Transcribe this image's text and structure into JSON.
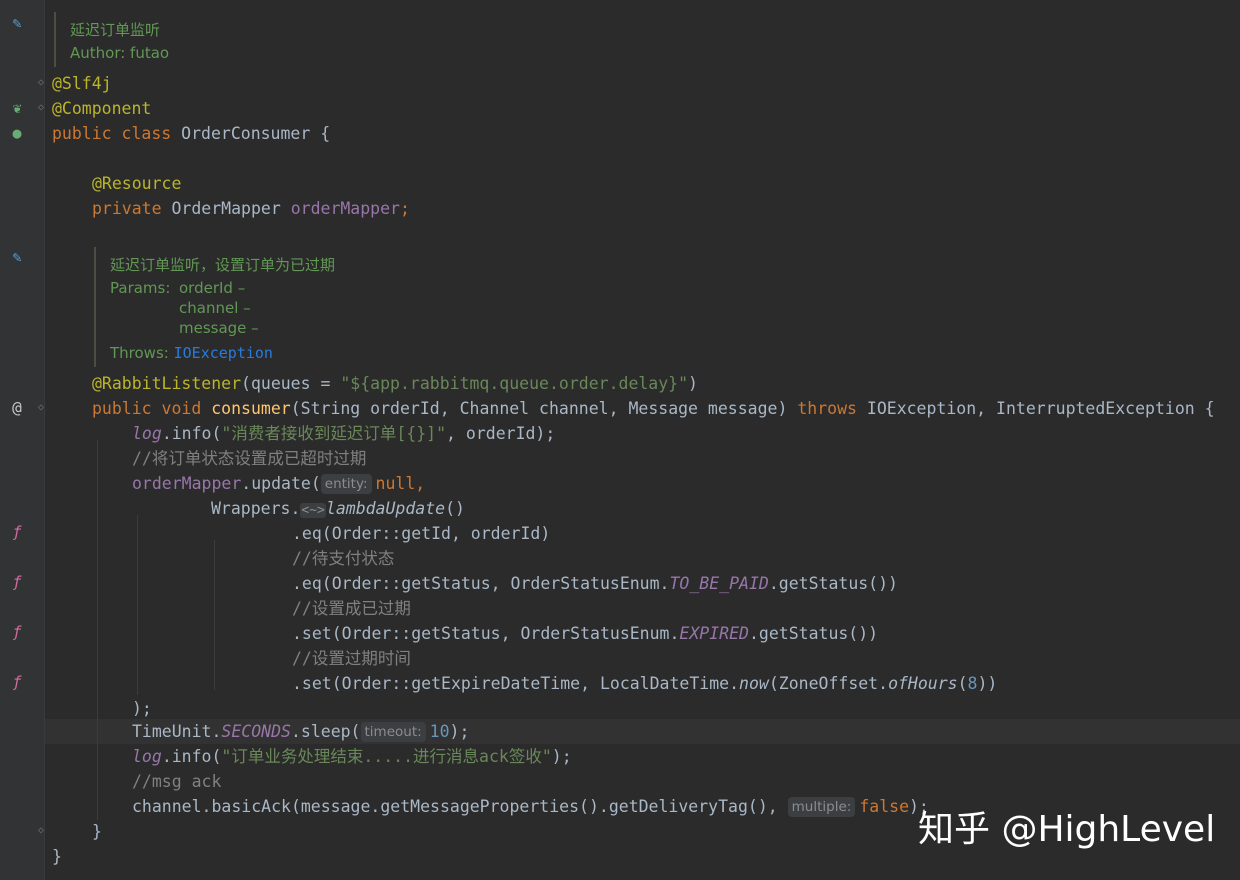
{
  "doc1": {
    "title": "延迟订单监听",
    "author": "Author: futao"
  },
  "anno": {
    "slf4j": "@Slf4j",
    "component": "@Component",
    "resource": "@Resource",
    "rabbit": "@RabbitListener"
  },
  "class_decl": {
    "pub": "public",
    "cls": "class",
    "name": "OrderConsumer {"
  },
  "field": {
    "kw": "private",
    "type": "OrderMapper",
    "name": "orderMapper",
    "semi": ";"
  },
  "doc2": {
    "title": "延迟订单监听，设置订单为已过期",
    "params_label": "Params:",
    "p1": "orderId –",
    "p2": "channel –",
    "p3": "message –",
    "throws_label": "Throws:",
    "throws_val": "IOException"
  },
  "listener": {
    "open": "(queues = ",
    "value": "\"${app.rabbitmq.queue.order.delay}\"",
    "close": ")"
  },
  "method": {
    "kw": "public void",
    "name": "consumer",
    "sig": "(String orderId, Channel channel, Message message) ",
    "throws_kw": "throws",
    "exc": " IOException, InterruptedException {"
  },
  "body": {
    "log1_obj": "log",
    "log1_call": ".info(",
    "log1_str": "\"消费者接收到延迟订单[{}]\"",
    "log1_tail": ", orderId);",
    "c1": "//将订单状态设置成已超时过期",
    "upd_obj": "orderMapper",
    "upd_call": ".update(",
    "hint_entity": "entity:",
    "upd_null": "null,",
    "wr1": "Wrappers.",
    "wr_diam": "<~>",
    "wr_fn": "lambdaUpdate",
    "wr_end": "()",
    "eq1": ".eq(Order::getId, orderId)",
    "c2": "//待支付状态",
    "eq2a": ".eq(Order::getStatus, OrderStatusEnum.",
    "eq2b": "TO_BE_PAID",
    "eq2c": ".getStatus())",
    "c3": "//设置成已过期",
    "set1a": ".set(Order::getStatus, OrderStatusEnum.",
    "set1b": "EXPIRED",
    "set1c": ".getStatus())",
    "c4": "//设置过期时间",
    "set2a": ".set(Order::getExpireDateTime, LocalDateTime.",
    "set2b": "now",
    "set2c": "(ZoneOffset.",
    "set2d": "ofHours",
    "set2e": "(",
    "set2num": "8",
    "set2f": "))",
    "close_paren": ");",
    "tu_a": "TimeUnit.",
    "tu_b": "SECONDS",
    "tu_c": ".sleep(",
    "hint_timeout": "timeout:",
    "tu_num": "10",
    "tu_d": ");",
    "log2_obj": "log",
    "log2_call": ".info(",
    "log2_str": "\"订单业务处理结束.....进行消息ack签收\"",
    "log2_tail": ");",
    "c5": "//msg ack",
    "ack_a": "channel.basicAck(message.getMessageProperties().getDeliveryTag(), ",
    "hint_multiple": "multiple:",
    "ack_false": "false",
    "ack_end": ");",
    "close_method": "}",
    "close_class": "}"
  },
  "watermark": "知乎 @HighLevel",
  "icons": [
    "pencil-icon",
    "spring-bean-icon",
    "spring-gutter-icon",
    "at-override-icon",
    "lambda-icon"
  ]
}
